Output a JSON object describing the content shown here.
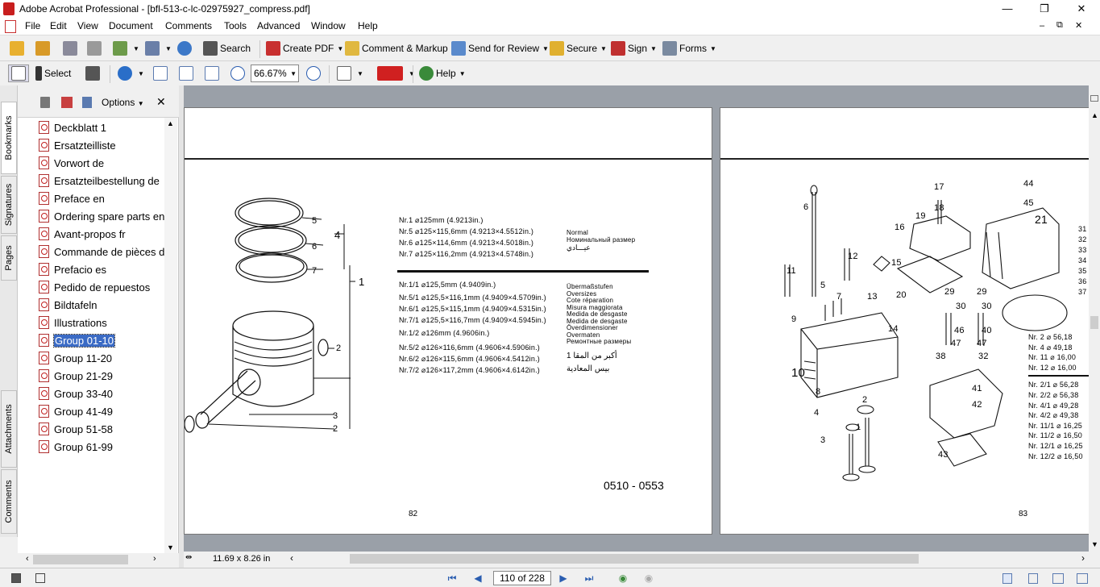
{
  "window": {
    "title": "Adobe Acrobat Professional - [bfl-513-c-lc-02975927_compress.pdf]",
    "min": "—",
    "restore": "❐",
    "close": "✕"
  },
  "menu": [
    "File",
    "Edit",
    "View",
    "Document",
    "Comments",
    "Tools",
    "Advanced",
    "Window",
    "Help"
  ],
  "toolbar1": {
    "search": "Search",
    "create_pdf": "Create PDF",
    "comment": "Comment & Markup",
    "review": "Send for Review",
    "secure": "Secure",
    "sign": "Sign",
    "forms": "Forms"
  },
  "toolbar2": {
    "select": "Select",
    "zoom": "66.67%",
    "help": "Help"
  },
  "tabs": [
    "Bookmarks",
    "Signatures",
    "Pages",
    "Attachments",
    "Comments"
  ],
  "bookmarks_header": {
    "options": "Options"
  },
  "bookmarks": [
    "Deckblatt 1",
    "Ersatzteilliste",
    "Vorwort de",
    "Ersatzteilbestellung de",
    "Preface en",
    "Ordering spare parts en",
    "Avant-propos fr",
    "Commande de pièces de",
    "Prefacio es",
    "Pedido de repuestos",
    "Bildtafeln",
    "Illustrations",
    "Group 01-10",
    "Group 11-20",
    "Group 21-29",
    "Group 33-40",
    "Group 41-49",
    "Group 51-58",
    "Group 61-99"
  ],
  "selected_bookmark": 12,
  "page_left": {
    "number": "82",
    "code": "0510 - 0553",
    "labels": [
      "5",
      "6",
      "7",
      "4",
      "1",
      "2",
      "3",
      "2"
    ],
    "sizes": [
      "Nr.1     ⌀125mm (4.9213in.)",
      "Nr.5     ⌀125×115,6mm (4.9213×4.5512in.)",
      "Nr.6     ⌀125×114,6mm (4.9213×4.5018in.)",
      "Nr.7     ⌀125×116,2mm (4.9213×4.5748in.)"
    ],
    "normal": [
      "Normal",
      "Номинальный размер",
      "عيـــادي"
    ],
    "oversizes": [
      "Nr.1/1  ⌀125,5mm (4.9409in.)",
      "Nr.5/1  ⌀125,5×116,1mm (4.9409×4.5709in.)",
      "Nr.6/1  ⌀125,5×115,1mm (4.9409×4.5315in.)",
      "Nr.7/1  ⌀125,5×116,7mm (4.9409×4.5945in.)",
      "Nr.1/2  ⌀126mm (4.9606in.)",
      "Nr.5/2  ⌀126×116,6mm (4.9606×4.5906in.)",
      "Nr.6/2  ⌀126×115,6mm (4.9606×4.5412in.)",
      "Nr.7/2  ⌀126×117,2mm (4.9606×4.6142in.)"
    ],
    "oversize_names": [
      "Übermaßstufen",
      "Oversizes",
      "Cote réparation",
      "Misura maggiorata",
      "Medida de desgaste",
      "Medida de desgaste",
      "Överdimensioner",
      "Overmaten",
      "Ремонтные размеры"
    ],
    "arabic": [
      "أكبر من المقا 1",
      "بيس المعادية"
    ]
  },
  "page_right": {
    "number": "83",
    "labels": [
      "6",
      "17",
      "18",
      "19",
      "16",
      "15",
      "44",
      "45",
      "21",
      "11",
      "12",
      "5",
      "7",
      "13",
      "20",
      "29",
      "29",
      "30",
      "30",
      "9",
      "14",
      "46",
      "40",
      "47",
      "47",
      "38",
      "32",
      "10",
      "8",
      "2",
      "4",
      "1",
      "3",
      "41",
      "42",
      "43"
    ],
    "table": [
      "Nr.  2   ⌀ 56,18",
      "Nr.  4   ⌀ 49,18",
      "Nr. 11   ⌀ 16,00",
      "Nr. 12   ⌀ 16,00",
      "Nr.  2/1 ⌀ 56,28",
      "Nr.  2/2 ⌀ 56,38",
      "Nr.  4/1 ⌀ 49,28",
      "Nr.  4/2 ⌀ 49,38",
      "Nr. 11/1 ⌀ 16,25",
      "Nr. 11/2 ⌀ 16,50",
      "Nr. 12/1 ⌀ 16,25",
      "Nr. 12/2 ⌀ 16,50"
    ],
    "side": [
      "31",
      "32",
      "33",
      "34",
      "35",
      "36",
      "37"
    ]
  },
  "status": {
    "page_size": "11.69 x 8.26 in",
    "page_field": "110 of 228"
  }
}
